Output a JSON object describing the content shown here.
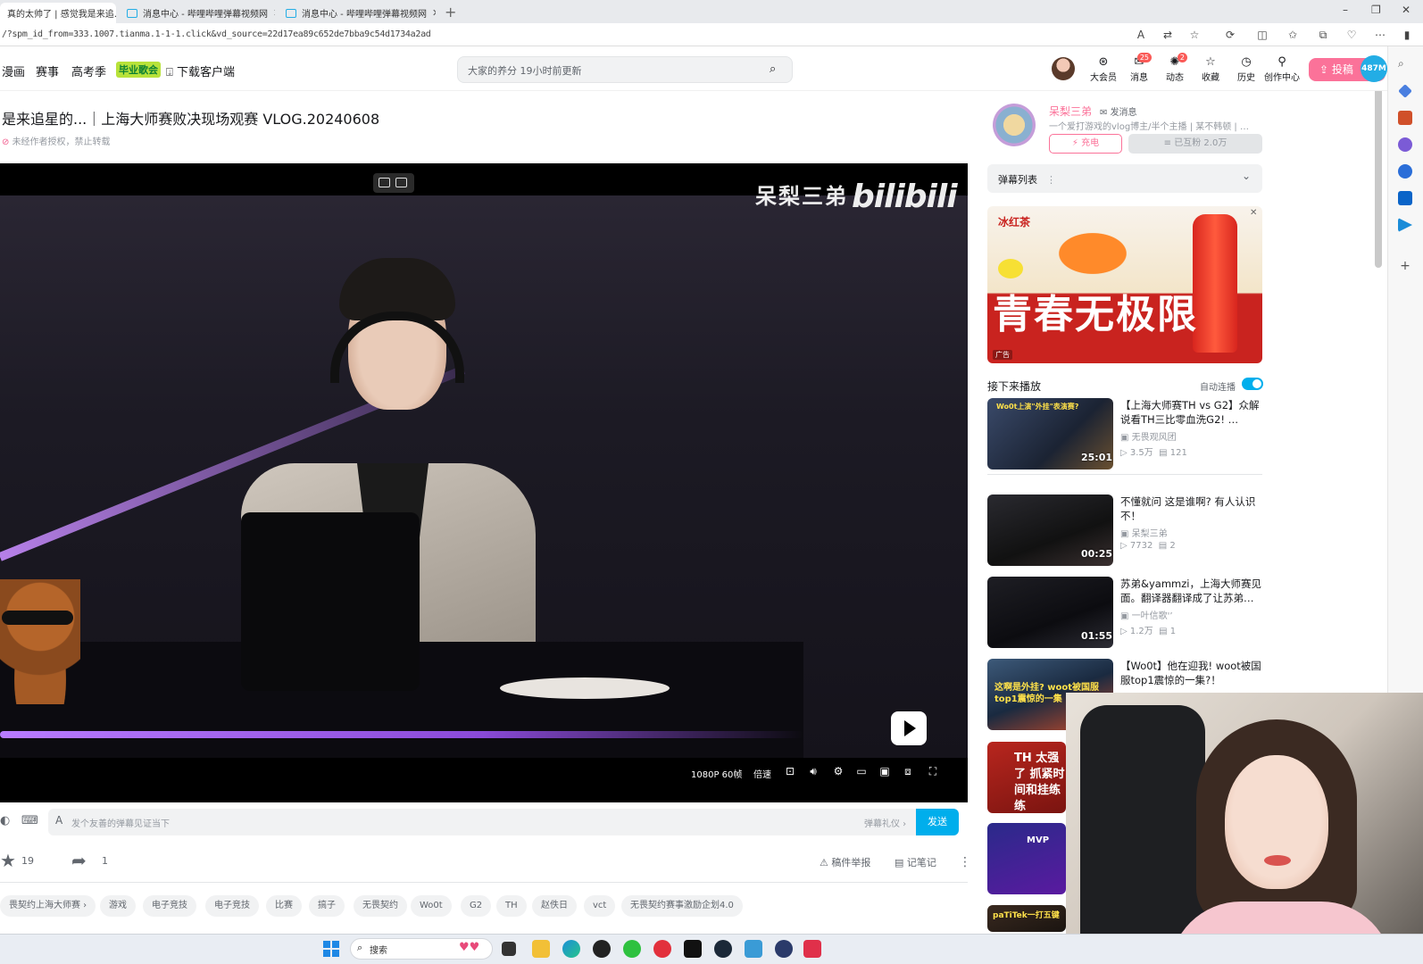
{
  "browser": {
    "tabs": [
      {
        "label": "真的太帅了 | 感觉我是来追…",
        "active": true
      },
      {
        "label": "消息中心 - 哔哩哔哩弹幕视频网",
        "active": false
      },
      {
        "label": "消息中心 - 哔哩哔哩弹幕视频网",
        "active": false
      }
    ],
    "url": "/?spm_id_from=333.1007.tianma.1-1-1.click&vd_source=22d17ea89c652de7bba9c54d1734a2ad"
  },
  "header": {
    "nav": [
      "漫画",
      "赛事",
      "高考季",
      "毕业歌会",
      "下载客户端"
    ],
    "search_placeholder": "大家的养分 19小时前更新",
    "items": [
      {
        "label": "大会员",
        "icon": "vip-icon",
        "badge": ""
      },
      {
        "label": "消息",
        "icon": "message-icon",
        "badge": "25"
      },
      {
        "label": "动态",
        "icon": "dynamic-icon",
        "badge": "2"
      },
      {
        "label": "收藏",
        "icon": "star-icon",
        "badge": ""
      },
      {
        "label": "历史",
        "icon": "clock-icon",
        "badge": ""
      },
      {
        "label": "创作中心",
        "icon": "bulb-icon",
        "badge": ""
      }
    ],
    "upload_label": "投稿",
    "upload_bubble": "487M"
  },
  "video": {
    "title": "是来追星的...｜上海大师赛败决现场观赛 VLOG.20240608",
    "copyright": "未经作者授权，禁止转载",
    "watermark_name": "呆梨三弟",
    "watermark_logo": "bilibili",
    "controls": {
      "quality": "1080P 60帧",
      "speed": "倍速"
    }
  },
  "danmaku": {
    "placeholder": "发个友善的弹幕见证当下",
    "etiquette": "弹幕礼仪 ›",
    "send": "发送"
  },
  "actions": {
    "favorite_count": "19",
    "share_count": "1",
    "report": "稿件举报",
    "notes": "记笔记"
  },
  "tags": [
    "畏契约上海大师赛 ›",
    "游戏",
    "电子竞技",
    "电子竞技",
    "比赛",
    "搞子",
    "无畏契约",
    "Wo0t",
    "G2",
    "TH",
    "赵佚日",
    "vct",
    "无畏契约赛事激励企划4.0"
  ],
  "uploader": {
    "name": "呆梨三弟",
    "message": "发消息",
    "desc": "一个爱打游戏的vlog博主/半个主播 | 某不韩顿 | …",
    "charge": "充电",
    "follow": "已互粉 2.0万"
  },
  "danmaku_list": {
    "label": "弹幕列表"
  },
  "ad": {
    "badge": "广告",
    "slogan": "青春无极限",
    "brand": "冰红茶"
  },
  "up_next": {
    "label": "接下来播放",
    "autoplay": "自动连播"
  },
  "recommendations": [
    {
      "title": "【上海大师赛TH vs G2】众解说看TH三比零血洗G2! …",
      "up": "无畏观风团",
      "views": "3.5万",
      "danmaku": "121",
      "duration": "25:01"
    },
    {
      "title": "不懂就问 这是谁啊? 有人认识不！",
      "up": "呆梨三弟",
      "views": "7732",
      "danmaku": "2",
      "duration": "00:25"
    },
    {
      "title": "苏弟&yammzi，上海大师赛见面。翻译器翻译成了让苏弟…",
      "up": "一叶信歌'’",
      "views": "1.2万",
      "danmaku": "1",
      "duration": "01:55"
    },
    {
      "title": "【Wo0t】他在迎我! woot被国服top1震惊的一集?！",
      "up": "",
      "views": "",
      "danmaku": "",
      "duration": ""
    }
  ],
  "thumb_texts": {
    "r1": "Wo0t上演\"外挂\"表演赛?",
    "r4": "这啊是外挂? woot被国服top1震惊的一集",
    "r5": "TH 太强了 抓紧时间和挂练练",
    "r6": "MVP",
    "r7": "paTiTek一打五键"
  },
  "taskbar": {
    "search": "搜索"
  }
}
